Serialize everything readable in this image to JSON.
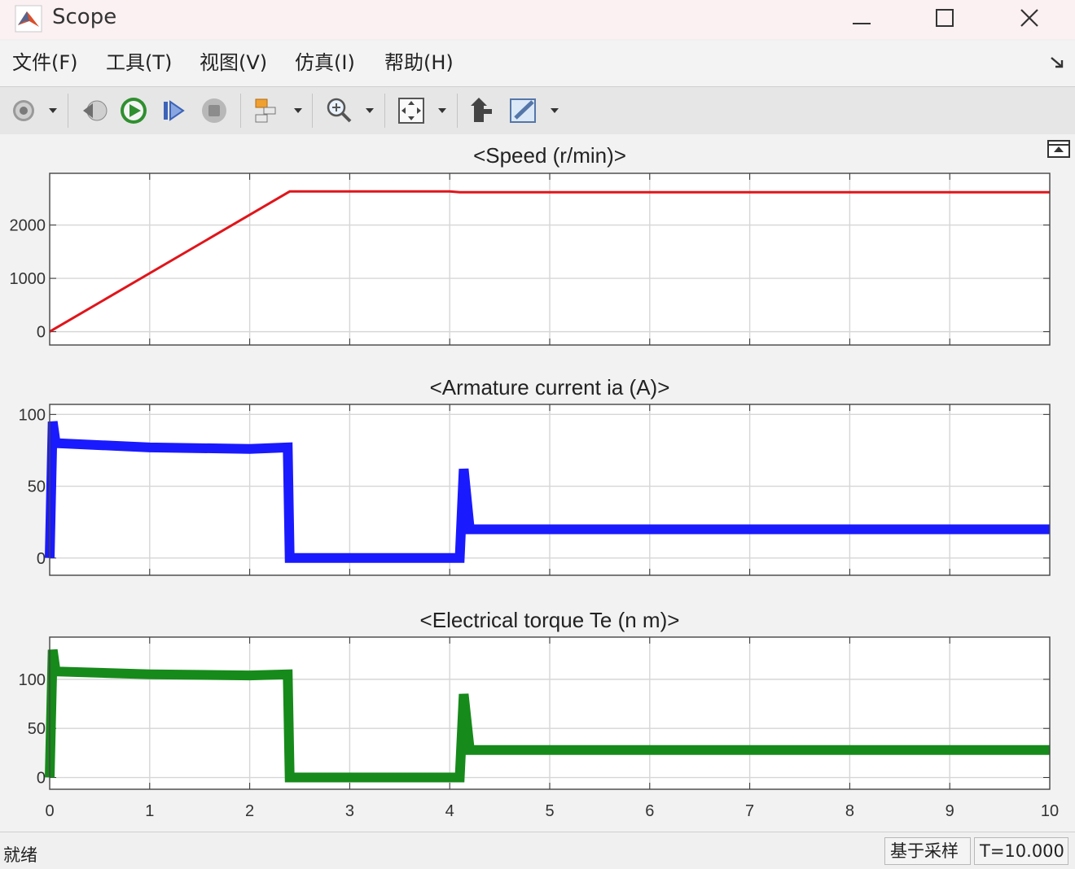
{
  "window": {
    "title": "Scope"
  },
  "menu": [
    "文件(F)",
    "工具(T)",
    "视图(V)",
    "仿真(I)",
    "帮助(H)"
  ],
  "toolbar": {
    "icons": [
      "gear-icon",
      "step-back-icon",
      "run-icon",
      "step-forward-icon",
      "stop-icon",
      "signal-selector-icon",
      "zoom-icon",
      "autoscale-icon",
      "highlight-block-icon",
      "style-icon"
    ]
  },
  "plots": [
    {
      "title": "<Speed (r/min)>",
      "color": "#e0151b",
      "yticks": [
        "0",
        "1000",
        "2000"
      ]
    },
    {
      "title": "<Armature current ia (A)>",
      "color": "#1a1aff",
      "yticks": [
        "0",
        "50",
        "100"
      ]
    },
    {
      "title": "<Electrical torque Te (n m)>",
      "color": "#168a1a",
      "yticks": [
        "0",
        "50",
        "100"
      ]
    }
  ],
  "xticks": [
    "0",
    "1",
    "2",
    "3",
    "4",
    "5",
    "6",
    "7",
    "8",
    "9",
    "10"
  ],
  "chart_data": [
    {
      "type": "line",
      "title": "<Speed (r/min)>",
      "xlim": [
        0,
        10
      ],
      "ylim": [
        -250,
        2970
      ],
      "grid": true,
      "x": [
        0,
        2.4,
        4.0,
        4.1,
        10
      ],
      "y": [
        0,
        2630,
        2630,
        2615,
        2615
      ]
    },
    {
      "type": "line",
      "title": "<Armature current ia (A)>",
      "xlim": [
        0,
        10
      ],
      "ylim": [
        -12,
        107
      ],
      "grid": true,
      "x": [
        0,
        0.03,
        0.06,
        1.0,
        2.0,
        2.38,
        2.4,
        4.0,
        4.1,
        4.14,
        4.2,
        4.3,
        10
      ],
      "y": [
        0,
        95,
        80,
        77,
        76,
        77,
        0,
        0,
        0,
        62,
        20,
        20,
        20
      ]
    },
    {
      "type": "line",
      "title": "<Electrical torque Te (n m)>",
      "xlim": [
        0,
        10
      ],
      "ylim": [
        -12,
        143
      ],
      "grid": true,
      "x": [
        0,
        0.03,
        0.06,
        1.0,
        2.0,
        2.38,
        2.4,
        4.0,
        4.1,
        4.14,
        4.2,
        4.3,
        10
      ],
      "y": [
        0,
        130,
        108,
        105,
        104,
        105,
        0,
        0,
        0,
        85,
        28,
        28,
        28
      ]
    }
  ],
  "status": {
    "text": "就绪",
    "mode": "基于采样",
    "time": "T=10.000"
  }
}
